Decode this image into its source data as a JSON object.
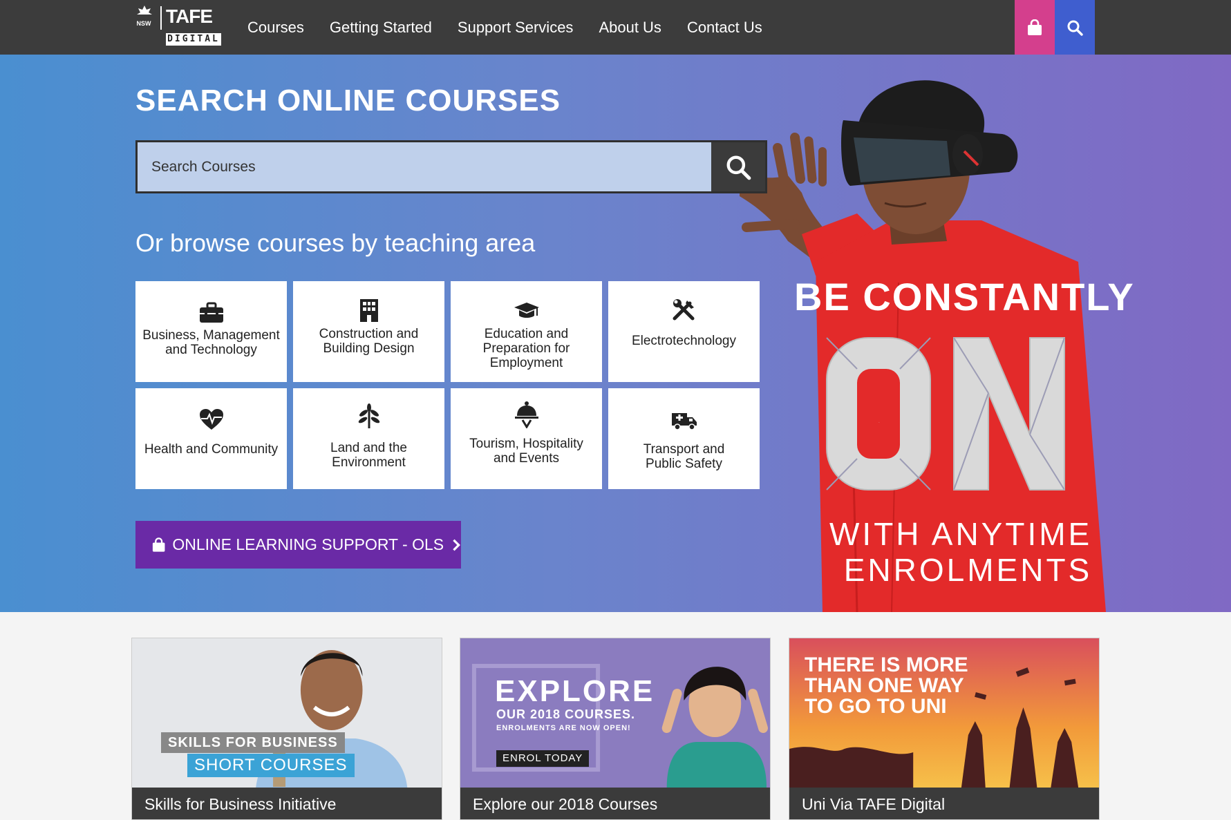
{
  "nav": {
    "logo_nsw": "NSW",
    "logo_tafe": "TAFE",
    "logo_digital": "DIGITAL",
    "links": [
      "Courses",
      "Getting Started",
      "Support Services",
      "About Us",
      "Contact Us"
    ],
    "cart_icon": "shopping-bag-icon",
    "search_icon": "search-icon"
  },
  "hero": {
    "title": "SEARCH ONLINE COURSES",
    "search_placeholder": "Search Courses",
    "browse_heading": "Or browse courses by teaching area",
    "areas": [
      {
        "label": "Business, Management and Technology",
        "icon": "briefcase-icon"
      },
      {
        "label": "Construction and Building Design",
        "icon": "building-icon"
      },
      {
        "label": "Education and Preparation for Employment",
        "icon": "graduation-cap-icon"
      },
      {
        "label": "Electrotechnology",
        "icon": "tools-icon"
      },
      {
        "label": "Health and Community",
        "icon": "heartbeat-icon"
      },
      {
        "label": "Land and the Environment",
        "icon": "plant-icon"
      },
      {
        "label": "Tourism, Hospitality and Events",
        "icon": "cloche-icon"
      },
      {
        "label": "Transport and Public Safety",
        "icon": "truck-icon"
      }
    ],
    "ols_label": "ONLINE LEARNING SUPPORT - OLS",
    "promo_line1": "BE CONSTANTLY",
    "promo_on": "ON",
    "promo_line2a": "WITH ANYTIME",
    "promo_line2b": "ENROLMENTS"
  },
  "cards": [
    {
      "caption": "Skills for Business Initiative",
      "tag1": "SKILLS FOR BUSINESS",
      "tag2": "SHORT COURSES"
    },
    {
      "caption": "Explore our 2018 Courses",
      "headline": "EXPLORE",
      "sub1": "OUR 2018 COURSES.",
      "sub2": "ENROLMENTS ARE NOW OPEN!",
      "cta": "ENROL TODAY"
    },
    {
      "caption": "Uni Via TAFE Digital",
      "headline1": "THERE IS MORE",
      "headline2": "THAN ONE WAY",
      "headline3": "TO GO TO UNI"
    }
  ],
  "colors": {
    "nav_bg": "#3c3c3c",
    "cart_btn": "#d43f8d",
    "search_btn": "#3f5ecf",
    "ols_btn": "#6a2aa6",
    "hero_left": "#4a8fd0",
    "hero_right": "#8069c4"
  }
}
